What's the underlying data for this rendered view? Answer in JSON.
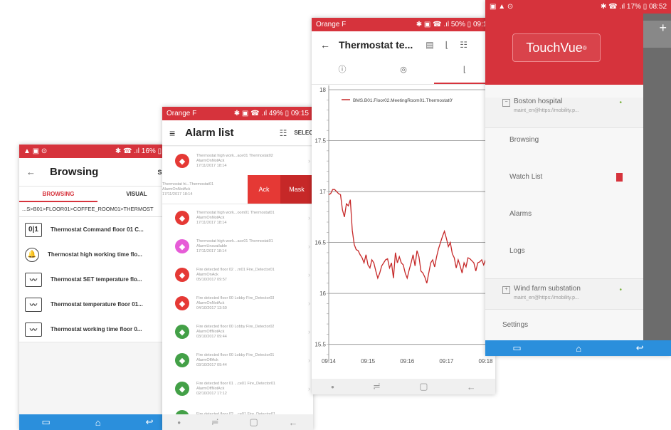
{
  "phone1": {
    "status_left": "▲ ▣ ⊙",
    "status_right": "✱ ☎ .ıl 16% ▯ 08",
    "title": "Browsing",
    "action": "SELE",
    "tabs": [
      "BROWSING",
      "VISUAL"
    ],
    "breadcrumb": "...S>B01>FLOOR01>COFFEE_ROOM01>THERMOST",
    "items": [
      {
        "icon": "0|1",
        "label": "Thermostat Command floor 01 C..."
      },
      {
        "icon": "🔔",
        "label": "Thermostat high working time flo..."
      },
      {
        "icon": "〰",
        "label": "Thermostat SET temperature flo..."
      },
      {
        "icon": "〰",
        "label": "Thermostat temperature floor 01..."
      },
      {
        "icon": "〰",
        "label": "Thermostat working time floor 0..."
      }
    ],
    "accent": "#d6333c",
    "nav_color": "#2b8fdc"
  },
  "phone2": {
    "status_left": "Orange F",
    "status_right": "✱ ▣ ☎ .ıl 49% ▯ 09:15",
    "title": "Alarm list",
    "action": "SELEC",
    "swipe_row": {
      "lines": [
        "Thermostat hi...Thermostat01",
        "AlarmOnNotAck",
        "17/11/2017 18:14"
      ],
      "ack": "Ack",
      "mask": "Mask"
    },
    "alarms": [
      {
        "color": "#e53935",
        "l1": "Thermostat high work...ace01 Thermostat02",
        "l2": "AlarmOnNotAck",
        "l3": "17/11/2017 18:14"
      },
      {
        "color": "#e53935",
        "l1": "Thermostat high work...oom01 Thermostat01",
        "l2": "AlarmOnNotAck",
        "l3": "17/11/2017 18:14"
      },
      {
        "color": "#e65cd7",
        "l1": "Thermostat high work...ace01 Thermostat01",
        "l2": "AlarmUnavailable",
        "l3": "17/11/2017 18:14"
      },
      {
        "color": "#e53935",
        "l1": "Fire detected floor 02 ...m01 Fire_Detector01",
        "l2": "AlarmOnAck",
        "l3": "05/10/2017 09:57"
      },
      {
        "color": "#e53935",
        "l1": "Fire detected floor 00 Lobby Fire_Detector03",
        "l2": "AlarmOnNotAck",
        "l3": "04/10/2017 13:50"
      },
      {
        "color": "#43a047",
        "l1": "Fire detected floor 00 Lobby Fire_Detector02",
        "l2": "AlarmOffNotAck",
        "l3": "03/10/2017 09:44"
      },
      {
        "color": "#43a047",
        "l1": "Fire detected floor 00 Lobby Fire_Detector01",
        "l2": "AlarmOffAck",
        "l3": "03/10/2017 09:44"
      },
      {
        "color": "#43a047",
        "l1": "Fire detected floor 01 ...ce01 Fire_Detector01",
        "l2": "AlarmOffNotAck",
        "l3": "02/10/2017 17:12"
      },
      {
        "color": "#43a047",
        "l1": "Fire detected floor 02 ...ce01 Fire_Detector01",
        "l2": "AlarmOffAck",
        "l3": ""
      }
    ]
  },
  "phone3": {
    "status_left": "Orange F",
    "status_right": "✱ ▣ ☎ .ıl 50% ▯ 09:18",
    "title": "Thermostat te...",
    "chart_data": {
      "type": "line",
      "title": "",
      "series": [
        {
          "name": "BMS.B01.Floor02.MeetingRoom01.Thermostat0'",
          "color": "#c62828",
          "x": [
            0,
            0.05,
            0.1,
            0.15,
            0.2,
            0.25,
            0.3,
            0.35,
            0.4,
            0.45,
            0.5,
            0.55,
            0.6,
            0.65,
            0.7,
            0.75,
            0.8,
            0.85,
            0.9,
            0.95,
            1.0,
            1.05,
            1.1,
            1.15,
            1.2,
            1.25,
            1.3,
            1.35,
            1.4,
            1.45,
            1.5,
            1.55,
            1.6,
            1.65,
            1.7,
            1.75,
            1.8,
            1.85,
            1.9,
            1.95,
            2.0,
            2.05,
            2.1,
            2.15,
            2.2,
            2.25,
            2.3,
            2.35,
            2.4,
            2.45,
            2.5,
            2.55,
            2.6,
            2.65,
            2.7,
            2.75,
            2.8,
            2.85,
            2.9,
            2.95,
            3.0,
            3.05,
            3.1,
            3.15,
            3.2,
            3.25,
            3.3,
            3.35,
            3.4,
            3.45,
            3.5,
            3.55,
            3.6,
            3.65,
            3.7,
            3.75,
            3.8,
            3.85,
            3.9,
            3.95,
            4.0,
            4.1
          ],
          "y": [
            16.97,
            16.98,
            17.02,
            17.02,
            17.0,
            16.98,
            16.97,
            16.82,
            16.75,
            16.88,
            16.86,
            16.92,
            16.62,
            16.48,
            16.43,
            16.42,
            16.38,
            16.35,
            16.3,
            16.38,
            16.28,
            16.25,
            16.33,
            16.3,
            16.22,
            16.15,
            16.2,
            16.27,
            16.3,
            16.33,
            16.34,
            16.25,
            16.3,
            16.15,
            16.4,
            16.3,
            16.36,
            16.3,
            16.28,
            16.2,
            16.15,
            16.23,
            16.3,
            16.38,
            16.27,
            16.42,
            16.36,
            16.22,
            16.2,
            16.16,
            16.1,
            16.2,
            16.3,
            16.33,
            16.26,
            16.36,
            16.44,
            16.5,
            16.56,
            16.61,
            16.54,
            16.46,
            16.5,
            16.39,
            16.35,
            16.25,
            16.33,
            16.27,
            16.2,
            16.3,
            16.26,
            16.35,
            16.34,
            16.32,
            16.3,
            16.22,
            16.3,
            16.31,
            16.33,
            16.28,
            16.33,
            16.34
          ]
        }
      ],
      "y_ticks": [
        18,
        17.5,
        17,
        16.5,
        16,
        15.5
      ],
      "x_ticks": [
        "09:14",
        "09:15",
        "09:16",
        "09:17",
        "09:18"
      ],
      "ylim": [
        15.33,
        18.0
      ],
      "xlim": [
        0,
        4.1
      ],
      "grid": true
    }
  },
  "phone4": {
    "status_left": "▣ ▲ ⊙",
    "status_right": "✱ ☎ .ıl 17% ▯ 08:52",
    "brand": "TouchVue",
    "brand_mark": "®",
    "sites": [
      {
        "name": "Boston hospital",
        "sub": "maint_en@https://mobility.p..."
      },
      {
        "name": "Wind farm substation",
        "sub": "maint_en@https://mobility.p..."
      }
    ],
    "menu": [
      "Browsing",
      "Watch List",
      "Alarms",
      "Logs"
    ],
    "settings": "Settings",
    "plus": "+"
  }
}
